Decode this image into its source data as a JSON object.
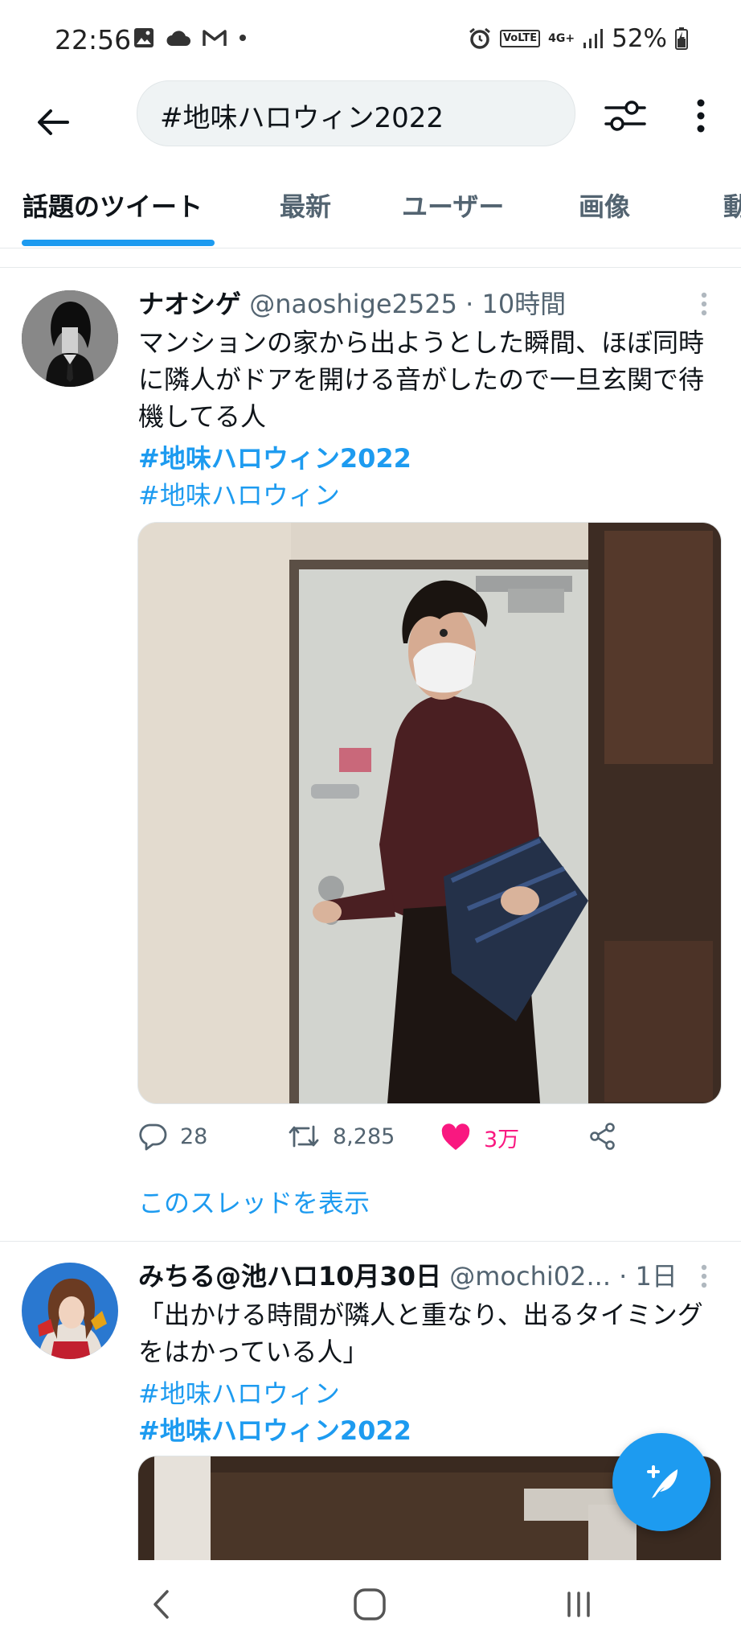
{
  "status_bar": {
    "time": "22:56",
    "battery": "52%",
    "network": "4G+",
    "volte": "VoLTE",
    "left_icons": [
      "gallery-icon",
      "cloud-icon",
      "gmail-icon",
      "dot-icon"
    ],
    "right_icons": [
      "alarm-icon",
      "volte-icon",
      "network-4g-icon",
      "signal-icon",
      "battery-icon"
    ]
  },
  "header": {
    "search_query": "#地味ハロウィン2022",
    "icons": [
      "back-arrow-icon",
      "filter-sliders-icon",
      "more-vertical-icon"
    ]
  },
  "tabs": [
    {
      "label": "話題のツイート",
      "active": true
    },
    {
      "label": "最新",
      "active": false
    },
    {
      "label": "ユーザー",
      "active": false
    },
    {
      "label": "画像",
      "active": false
    },
    {
      "label": "動",
      "active": false
    }
  ],
  "tweets": [
    {
      "display_name": "ナオシゲ",
      "handle": "@naoshige2525",
      "time": "· 10時間",
      "text": "マンションの家から出ようとした瞬間、ほぼ同時に隣人がドアを開ける音がしたので一旦玄関で待機してる人",
      "hashtags": [
        "#地味ハロウィン2022",
        "#地味ハロウィン"
      ],
      "replies": "28",
      "retweets": "8,285",
      "likes": "3万",
      "liked": true,
      "thread_link": "このスレッドを表示"
    },
    {
      "display_name": "みちる@池ハロ10月30日",
      "handle": "@mochi02...",
      "time": "· 1日",
      "text": "「出かける時間が隣人と重なり、出るタイミングをはかっている人」",
      "hashtags": [
        "#地味ハロウィン",
        "#地味ハロウィン2022"
      ]
    }
  ],
  "colors": {
    "accent": "#1d9bf0",
    "like": "#f91880",
    "secondary_text": "#536471",
    "primary_text": "#0f1419"
  },
  "fab": {
    "icon": "compose-feather-icon"
  },
  "nav_bar": {
    "icons": [
      "nav-back-icon",
      "nav-home-icon",
      "nav-recents-icon"
    ]
  }
}
